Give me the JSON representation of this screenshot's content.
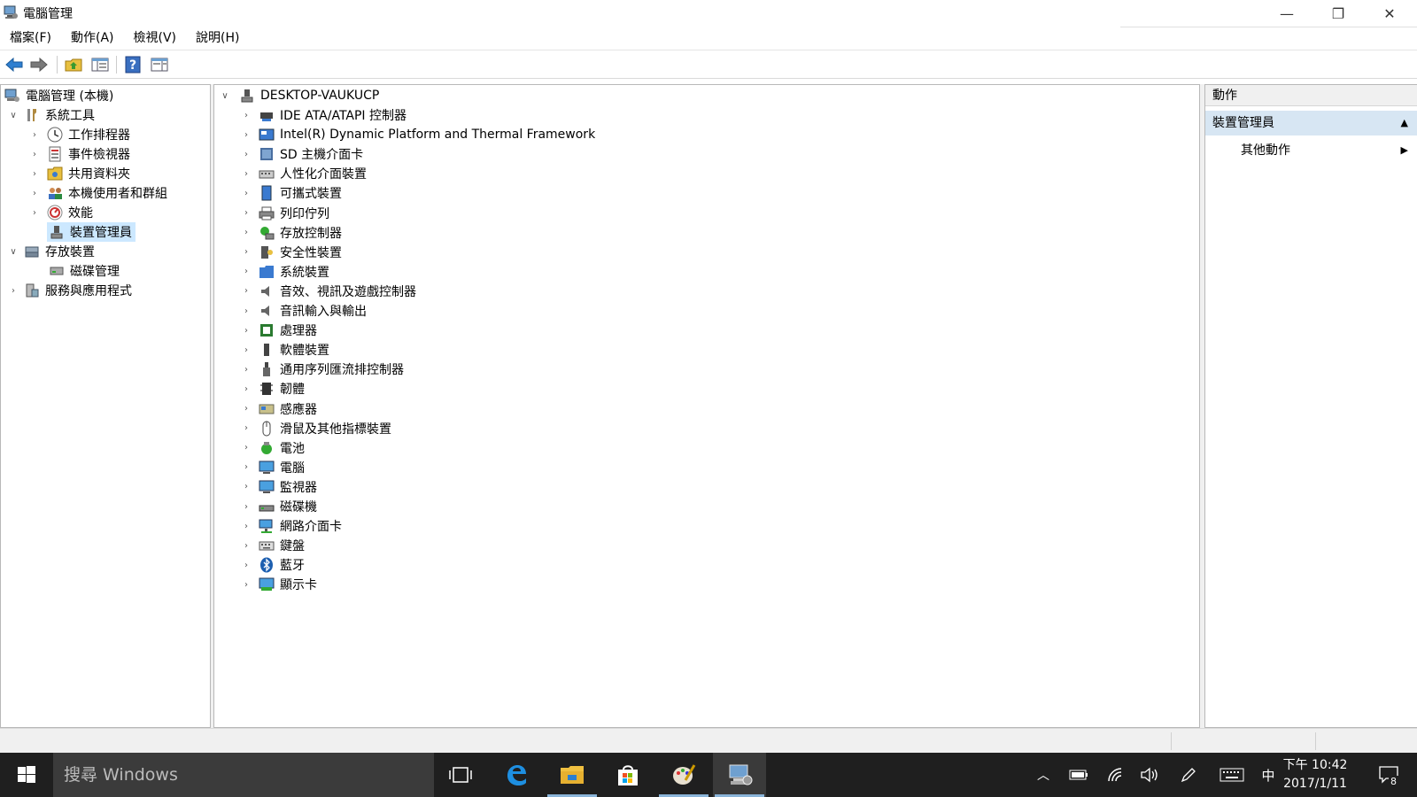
{
  "window": {
    "title": "電腦管理",
    "minimize_glyph": "—",
    "restore_glyph": "❐",
    "close_glyph": "✕"
  },
  "menu": [
    "檔案(F)",
    "動作(A)",
    "檢視(V)",
    "說明(H)"
  ],
  "toolbar": {
    "buttons": [
      "back-arrow-icon",
      "forward-arrow-icon",
      "up-folder-icon",
      "console-tree-icon",
      "help-icon",
      "properties-icon"
    ]
  },
  "tree": {
    "root": "電腦管理 (本機)",
    "system_tools": "系統工具",
    "task_scheduler": "工作排程器",
    "event_viewer": "事件檢視器",
    "shared_folders": "共用資料夾",
    "local_users": "本機使用者和群組",
    "performance": "效能",
    "device_manager": "裝置管理員",
    "storage": "存放裝置",
    "disk_management": "磁碟管理",
    "services_apps": "服務與應用程式"
  },
  "devices": {
    "computer_name": "DESKTOP-VAUKUCP",
    "items": [
      "IDE ATA/ATAPI 控制器",
      "Intel(R) Dynamic Platform and Thermal Framework",
      "SD 主機介面卡",
      "人性化介面裝置",
      "可攜式裝置",
      "列印佇列",
      "存放控制器",
      "安全性裝置",
      "系統裝置",
      "音效、視訊及遊戲控制器",
      "音訊輸入與輸出",
      "處理器",
      "軟體裝置",
      "通用序列匯流排控制器",
      "韌體",
      "感應器",
      "滑鼠及其他指標裝置",
      "電池",
      "電腦",
      "監視器",
      "磁碟機",
      "網路介面卡",
      "鍵盤",
      "藍牙",
      "顯示卡"
    ]
  },
  "actions": {
    "header": "動作",
    "section": "裝置管理員",
    "more": "其他動作"
  },
  "taskbar": {
    "search_placeholder": "搜尋 Windows",
    "ime": "中",
    "time": "下午 10:42",
    "date": "2017/1/11",
    "notification_count": "8"
  }
}
